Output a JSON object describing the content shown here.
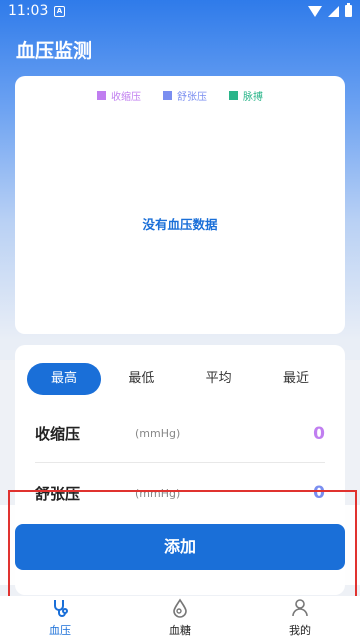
{
  "status_bar": {
    "time": "11:03",
    "notification_icon": "A"
  },
  "header": {
    "title": "血压监测"
  },
  "chart": {
    "legend": [
      {
        "label": "收缩压",
        "color": "#c07ef0"
      },
      {
        "label": "舒张压",
        "color": "#7a8ef0"
      },
      {
        "label": "脉搏",
        "color": "#2bb58a"
      }
    ],
    "empty_message": "没有血压数据"
  },
  "tabs": [
    {
      "label": "最高",
      "active": true
    },
    {
      "label": "最低",
      "active": false
    },
    {
      "label": "平均",
      "active": false
    },
    {
      "label": "最近",
      "active": false
    }
  ],
  "metrics": [
    {
      "label": "收缩压",
      "unit": "(mmHg)",
      "value": "0",
      "color": "#c07ef0"
    },
    {
      "label": "舒张压",
      "unit": "(mmHg)",
      "value": "0",
      "color": "#7a8ef0"
    }
  ],
  "add_button": {
    "label": "添加"
  },
  "nav": [
    {
      "label": "血压",
      "icon": "stethoscope-icon",
      "active": true,
      "color": "#1a6fd8"
    },
    {
      "label": "血糖",
      "icon": "blood-drop-icon",
      "active": false,
      "color": "#222222"
    },
    {
      "label": "我的",
      "icon": "user-icon",
      "active": false,
      "color": "#222222"
    }
  ]
}
